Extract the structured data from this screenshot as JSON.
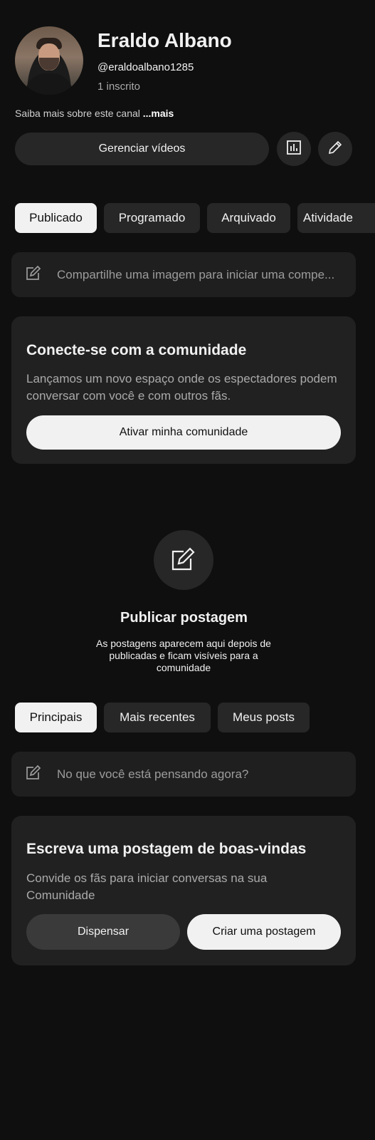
{
  "channel": {
    "name": "Eraldo Albano",
    "handle": "@eraldoalbano1285",
    "subscribers": "1 inscrito",
    "about_text": "Saiba mais sobre este canal ",
    "about_more": "...mais"
  },
  "actions": {
    "manage_label": "Gerenciar vídeos",
    "analytics_icon": "analytics-icon",
    "edit_icon": "pencil-icon"
  },
  "post_tabs": [
    {
      "label": "Publicado",
      "active": true
    },
    {
      "label": "Programado",
      "active": false
    },
    {
      "label": "Arquivado",
      "active": false
    },
    {
      "label": "Atividade",
      "active": false
    }
  ],
  "compose_top": {
    "placeholder": "Compartilhe uma imagem para iniciar uma compe..."
  },
  "community_card": {
    "title": "Conecte-se com a comunidade",
    "text": "Lançamos um novo espaço onde os espectadores podem conversar com você e com outros fãs.",
    "button": "Ativar minha comunidade"
  },
  "empty_state": {
    "title": "Publicar postagem",
    "text": "As postagens aparecem aqui depois de publicadas e ficam visíveis para a comunidade"
  },
  "filter_tabs": [
    {
      "label": "Principais",
      "active": true
    },
    {
      "label": "Mais recentes",
      "active": false
    },
    {
      "label": "Meus posts",
      "active": false
    }
  ],
  "compose_bottom": {
    "placeholder": "No que você está pensando agora?"
  },
  "welcome_card": {
    "title": "Escreva uma postagem de boas-vindas",
    "text": "Convide os fãs para iniciar conversas na sua Comunidade",
    "dismiss": "Dispensar",
    "create": "Criar uma postagem"
  },
  "colors": {
    "background": "#0f0f0f",
    "surface": "#212121",
    "chip": "#272727",
    "active_chip": "#f1f1f1"
  }
}
